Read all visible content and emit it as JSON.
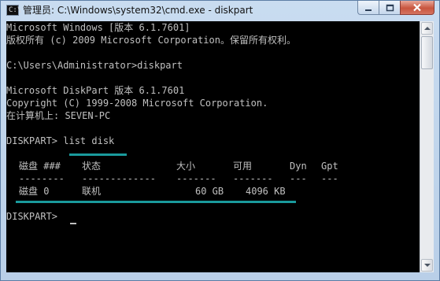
{
  "window": {
    "title": "管理员: C:\\Windows\\system32\\cmd.exe - diskpart",
    "icon_text": "C:\\"
  },
  "console": {
    "lines": [
      "Microsoft Windows [版本 6.1.7601]",
      "版权所有 (c) 2009 Microsoft Corporation。保留所有权利。",
      "",
      "C:\\Users\\Administrator>diskpart",
      "",
      "Microsoft DiskPart 版本 6.1.7601",
      "Copyright (C) 1999-2008 Microsoft Corporation.",
      "在计算机上: SEVEN-PC",
      "",
      "DISKPART> list disk",
      ""
    ],
    "table": {
      "headers": [
        "磁盘 ###",
        "状态",
        "大小",
        "可用",
        "Dyn",
        "Gpt"
      ],
      "separators": [
        "--------",
        "-------------",
        "-------",
        "-------",
        "---",
        "---"
      ],
      "rows": [
        [
          "磁盘 0",
          "联机",
          "60 GB",
          "4096 KB",
          "",
          ""
        ]
      ]
    },
    "prompt": "DISKPART> "
  },
  "colors": {
    "console_bg": "#000000",
    "console_text": "#c0c0c0",
    "highlight": "#1a9a9c"
  }
}
